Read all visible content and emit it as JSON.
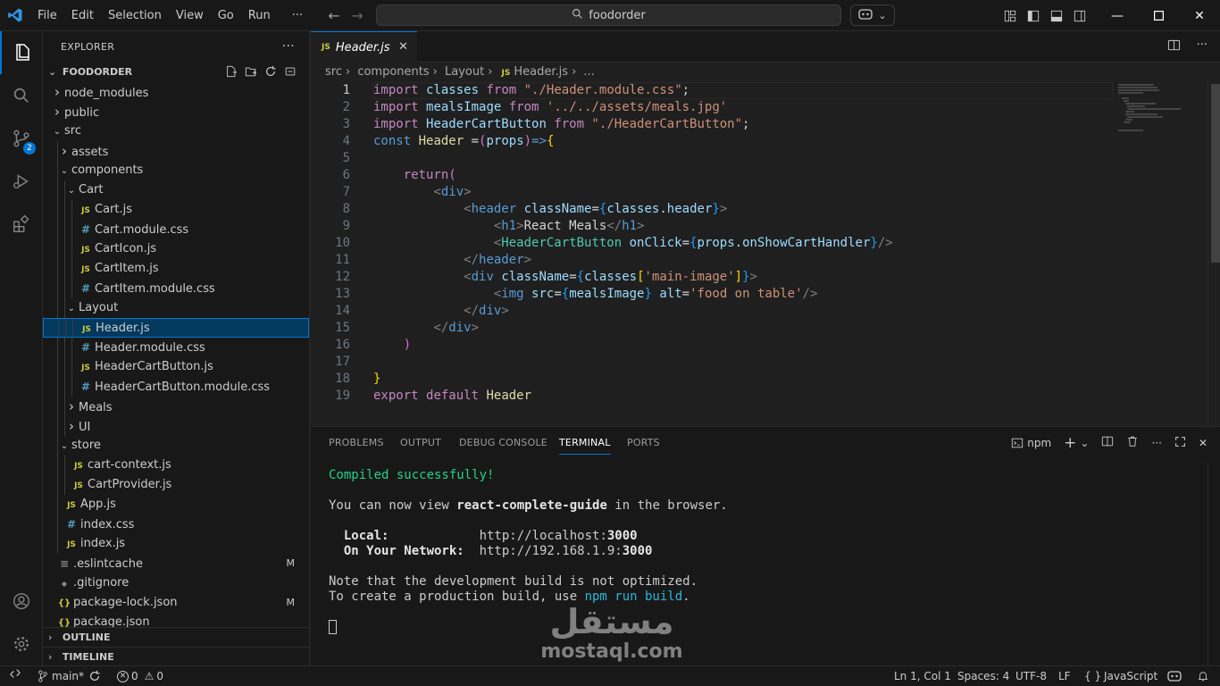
{
  "menu": [
    "File",
    "Edit",
    "Selection",
    "View",
    "Go",
    "Run"
  ],
  "menu_more": "···",
  "search": {
    "text": "foodorder"
  },
  "sidebar": {
    "title": "EXPLORER",
    "more": "···",
    "folder": "FOODORDER",
    "tree": [
      {
        "label": "node_modules",
        "type": "folder",
        "state": "collapsed",
        "depth": 1
      },
      {
        "label": "public",
        "type": "folder",
        "state": "collapsed",
        "depth": 1
      },
      {
        "label": "src",
        "type": "folder",
        "state": "expanded",
        "depth": 1
      },
      {
        "label": "assets",
        "type": "folder",
        "state": "collapsed",
        "depth": 2
      },
      {
        "label": "components",
        "type": "folder",
        "state": "expanded",
        "depth": 2
      },
      {
        "label": "Cart",
        "type": "folder",
        "state": "expanded",
        "depth": 3
      },
      {
        "label": "Cart.js",
        "type": "js",
        "depth": 4
      },
      {
        "label": "Cart.module.css",
        "type": "css",
        "depth": 4
      },
      {
        "label": "CartIcon.js",
        "type": "js",
        "depth": 4
      },
      {
        "label": "CartItem.js",
        "type": "js",
        "depth": 4
      },
      {
        "label": "CartItem.module.css",
        "type": "css",
        "depth": 4
      },
      {
        "label": "Layout",
        "type": "folder",
        "state": "expanded",
        "depth": 3
      },
      {
        "label": "Header.js",
        "type": "js",
        "depth": 4,
        "selected": true
      },
      {
        "label": "Header.module.css",
        "type": "css",
        "depth": 4
      },
      {
        "label": "HeaderCartButton.js",
        "type": "js",
        "depth": 4
      },
      {
        "label": "HeaderCartButton.module.css",
        "type": "css",
        "depth": 4
      },
      {
        "label": "Meals",
        "type": "folder",
        "state": "collapsed",
        "depth": 3
      },
      {
        "label": "UI",
        "type": "folder",
        "state": "collapsed",
        "depth": 3
      },
      {
        "label": "store",
        "type": "folder",
        "state": "expanded",
        "depth": 2
      },
      {
        "label": "cart-context.js",
        "type": "js",
        "depth": 3
      },
      {
        "label": "CartProvider.js",
        "type": "js",
        "depth": 3
      },
      {
        "label": "App.js",
        "type": "js",
        "depth": 2
      },
      {
        "label": "index.css",
        "type": "css",
        "depth": 2
      },
      {
        "label": "index.js",
        "type": "js",
        "depth": 2
      },
      {
        "label": ".eslintcache",
        "type": "txt",
        "depth": 1,
        "status": "M"
      },
      {
        "label": ".gitignore",
        "type": "git",
        "depth": 1
      },
      {
        "label": "package-lock.json",
        "type": "json",
        "depth": 1,
        "status": "M"
      },
      {
        "label": "package.json",
        "type": "json",
        "depth": 1
      }
    ],
    "outline": "OUTLINE",
    "timeline": "TIMELINE"
  },
  "activity": {
    "scm_badge": "2"
  },
  "editor": {
    "tab": "Header.js",
    "breadcrumb": [
      "src",
      "components",
      "Layout",
      "Header.js",
      "..."
    ],
    "line_numbers": [
      "1",
      "2",
      "3",
      "4",
      "5",
      "6",
      "7",
      "8",
      "9",
      "10",
      "11",
      "12",
      "13",
      "14",
      "15",
      "16",
      "17",
      "18",
      "19"
    ]
  },
  "panel": {
    "tabs": [
      "PROBLEMS",
      "OUTPUT",
      "DEBUG CONSOLE",
      "TERMINAL",
      "PORTS"
    ],
    "active_tab": "TERMINAL",
    "shell": "npm",
    "terminal": {
      "compiled": "Compiled successfully!",
      "view_prefix": "You can now view ",
      "app_name": "react-complete-guide",
      "view_suffix": " in the browser.",
      "local_label": "  Local:            ",
      "local_url": "http://localhost:",
      "local_port": "3000",
      "network_label": "  On Your Network:  ",
      "network_url": "http://192.168.1.9:",
      "network_port": "3000",
      "note": "Note that the development build is not optimized.",
      "prod_prefix": "To create a production build, use ",
      "prod_cmd": "npm run build",
      "prod_suffix": "."
    },
    "watermark_ar": "مستقل",
    "watermark_en": "mostaql.com"
  },
  "status": {
    "branch": "main*",
    "errors": "0",
    "warnings": "0",
    "position": "Ln 1, Col 1",
    "spaces": "Spaces: 4",
    "encoding": "UTF-8",
    "eol": "LF",
    "braces": "{ }",
    "language": "JavaScript"
  },
  "colors": {
    "accent": "#0078d4",
    "selection": "#04395e",
    "terminal_green": "#23d18b"
  }
}
